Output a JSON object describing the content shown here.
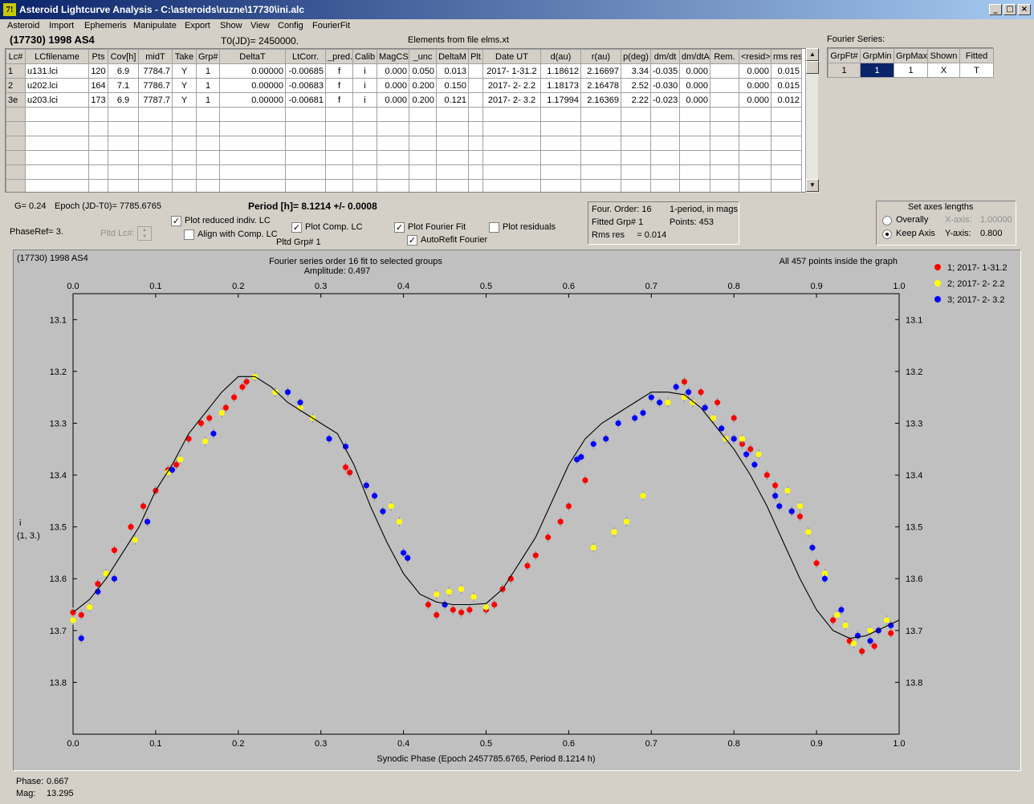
{
  "window": {
    "title": "Asteroid Lightcurve Analysis - C:\\asteroids\\ruzne\\17730\\ini.alc",
    "app_icon": "7!"
  },
  "menu": [
    "Asteroid",
    "Import",
    "Ephemeris",
    "Manipulate",
    "Export",
    "Show",
    "View",
    "Config",
    "FourierFit"
  ],
  "header": {
    "object": "(17730) 1998 AS4",
    "t0": "T0(JD)= 2450000.",
    "elements": "Elements from file elms.xt"
  },
  "lc_table": {
    "columns": [
      "Lc#",
      "LCfilename",
      "Pts",
      "Cov[h]",
      "midT",
      "Take",
      "Grp#",
      "DeltaT",
      "LtCorr.",
      "_pred.",
      "Calib",
      "MagCS",
      "_unc",
      "DeltaM",
      "Plt",
      "Date UT",
      "d(au)",
      "r(au)",
      "p(deg)",
      "dm/dt",
      "dm/dtA",
      "Rem.",
      "<resid>",
      "rms res"
    ],
    "rows": [
      [
        "1",
        "u131.lci",
        "120",
        "6.9",
        "7784.7",
        "Y",
        "1",
        "0.00000",
        "-0.00685",
        "f",
        "i",
        "0.000",
        "0.050",
        "0.013",
        "",
        "2017- 1-31.2",
        "1.18612",
        "2.16697",
        "3.34",
        "-0.035",
        "0.000",
        "",
        "0.000",
        "0.015"
      ],
      [
        "2",
        "u202.lci",
        "164",
        "7.1",
        "7786.7",
        "Y",
        "1",
        "0.00000",
        "-0.00683",
        "f",
        "i",
        "0.000",
        "0.200",
        "0.150",
        "",
        "2017- 2- 2.2",
        "1.18173",
        "2.16478",
        "2.52",
        "-0.030",
        "0.000",
        "",
        "0.000",
        "0.015"
      ],
      [
        "3e",
        "u203.lci",
        "173",
        "6.9",
        "7787.7",
        "Y",
        "1",
        "0.00000",
        "-0.00681",
        "f",
        "i",
        "0.000",
        "0.200",
        "0.121",
        "",
        "2017- 2- 3.2",
        "1.17994",
        "2.16369",
        "2.22",
        "-0.023",
        "0.000",
        "",
        "0.000",
        "0.012"
      ]
    ]
  },
  "fourier_series": {
    "label": "Fourier Series:",
    "columns": [
      "GrpFt#",
      "GrpMin",
      "GrpMax",
      "Shown",
      "Fitted"
    ],
    "row": [
      "1",
      "1",
      "1",
      "X",
      "T"
    ]
  },
  "params": {
    "g": "G= 0.24",
    "epoch": "Epoch (JD-T0)= 7785.6765",
    "period": "Period [h]= 8.1214 +/- 0.0008",
    "phaseref": "PhaseRef= 3.",
    "pltd_lc": "Pltd Lc#:",
    "pltd_grp": "Pltd Grp#  1"
  },
  "checkboxes": {
    "plot_reduced": {
      "label": "Plot reduced indiv. LC",
      "checked": true
    },
    "align_comp": {
      "label": "Align with Comp. LC",
      "checked": false
    },
    "plot_comp": {
      "label": "Plot Comp. LC",
      "checked": true
    },
    "plot_fourier": {
      "label": "Plot Fourier Fit",
      "checked": true
    },
    "plot_residuals": {
      "label": "Plot residuals",
      "checked": false
    },
    "autorefit": {
      "label": "AutoRefit Fourier",
      "checked": true
    }
  },
  "fit_info": {
    "order": "Four. Order: 16",
    "period_mode": "1-period, in mags",
    "fitted_grp": "Fitted Grp# 1",
    "points": "Points: 453",
    "rms": "Rms res     = 0.014"
  },
  "axes_box": {
    "title": "Set axes lengths",
    "overally": "Overally",
    "keep_axis": "Keep Axis",
    "x_label": "X-axis:",
    "x_value": "1.00000",
    "y_label": "Y-axis:",
    "y_value": "0.800",
    "selected": "keep_axis"
  },
  "status": {
    "phase_label": "Phase:",
    "phase_value": "0.667",
    "mag_label": "Mag:",
    "mag_value": "13.295"
  },
  "chart_data": {
    "type": "scatter",
    "title_left": "(17730) 1998 AS4",
    "title": "Fourier series order 16 fit to selected groups",
    "subtitle": "Amplitude: 0.497",
    "note_right": "All 457 points inside the graph",
    "xlabel": "Synodic Phase (Epoch 2457785.6765, Period 8.1214 h)",
    "ylabel": "i",
    "ylabel2": "(1, 3.)",
    "xlim": [
      0,
      1
    ],
    "ylim": [
      13.1,
      13.9
    ],
    "y_inverted": true,
    "xticks": [
      0,
      0.1,
      0.2,
      0.3,
      0.4,
      0.5,
      0.6,
      0.7,
      0.8,
      0.9,
      1
    ],
    "xtick_labels": [
      "0.0",
      "0.1",
      "0.2",
      "0.3",
      "0.4",
      "0.5",
      "0.6",
      "0.7",
      "0.8",
      "0.9",
      "1.0"
    ],
    "yticks": [
      13.1,
      13.2,
      13.3,
      13.4,
      13.5,
      13.6,
      13.7,
      13.8
    ],
    "ytick_labels": [
      "13.1",
      "13.2",
      "13.3",
      "13.4",
      "13.5",
      "13.6",
      "13.7",
      "13.8"
    ],
    "background": "#c0c0c0",
    "fit_curve": {
      "x": [
        0.0,
        0.02,
        0.04,
        0.06,
        0.08,
        0.1,
        0.12,
        0.14,
        0.16,
        0.18,
        0.2,
        0.22,
        0.24,
        0.26,
        0.28,
        0.3,
        0.32,
        0.34,
        0.36,
        0.38,
        0.4,
        0.42,
        0.44,
        0.46,
        0.48,
        0.5,
        0.52,
        0.54,
        0.56,
        0.58,
        0.6,
        0.62,
        0.64,
        0.66,
        0.68,
        0.7,
        0.72,
        0.74,
        0.76,
        0.78,
        0.8,
        0.82,
        0.84,
        0.86,
        0.88,
        0.9,
        0.92,
        0.94,
        0.96,
        0.98,
        1.0
      ],
      "y": [
        13.665,
        13.64,
        13.6,
        13.55,
        13.5,
        13.43,
        13.38,
        13.32,
        13.28,
        13.24,
        13.21,
        13.21,
        13.23,
        13.26,
        13.28,
        13.3,
        13.32,
        13.38,
        13.46,
        13.53,
        13.59,
        13.63,
        13.645,
        13.65,
        13.65,
        13.648,
        13.62,
        13.57,
        13.52,
        13.45,
        13.38,
        13.33,
        13.3,
        13.28,
        13.26,
        13.24,
        13.24,
        13.245,
        13.27,
        13.31,
        13.35,
        13.4,
        13.46,
        13.53,
        13.6,
        13.66,
        13.7,
        13.715,
        13.71,
        13.695,
        13.68
      ]
    },
    "series": [
      {
        "name": "1; 2017- 1-31.2",
        "color": "#ff0000",
        "x": [
          0.0,
          0.01,
          0.03,
          0.05,
          0.07,
          0.085,
          0.1,
          0.115,
          0.125,
          0.14,
          0.155,
          0.165,
          0.185,
          0.195,
          0.205,
          0.21,
          0.33,
          0.335,
          0.43,
          0.44,
          0.46,
          0.47,
          0.48,
          0.5,
          0.51,
          0.52,
          0.53,
          0.55,
          0.56,
          0.575,
          0.59,
          0.6,
          0.62,
          0.74,
          0.76,
          0.78,
          0.8,
          0.81,
          0.82,
          0.84,
          0.85,
          0.87,
          0.88,
          0.9,
          0.92,
          0.94,
          0.955,
          0.97,
          0.99
        ],
        "y": [
          13.665,
          13.67,
          13.61,
          13.545,
          13.5,
          13.46,
          13.43,
          13.39,
          13.38,
          13.33,
          13.3,
          13.29,
          13.27,
          13.25,
          13.23,
          13.22,
          13.385,
          13.395,
          13.65,
          13.67,
          13.66,
          13.665,
          13.66,
          13.66,
          13.65,
          13.62,
          13.6,
          13.575,
          13.555,
          13.52,
          13.49,
          13.46,
          13.41,
          13.22,
          13.24,
          13.26,
          13.29,
          13.34,
          13.35,
          13.4,
          13.42,
          13.47,
          13.48,
          13.57,
          13.68,
          13.72,
          13.74,
          13.73,
          13.705
        ]
      },
      {
        "name": "2; 2017- 2- 2.2",
        "color": "#ffff00",
        "x": [
          0.0,
          0.02,
          0.04,
          0.075,
          0.115,
          0.13,
          0.16,
          0.18,
          0.22,
          0.245,
          0.275,
          0.29,
          0.385,
          0.395,
          0.44,
          0.455,
          0.47,
          0.485,
          0.5,
          0.63,
          0.655,
          0.67,
          0.69,
          0.72,
          0.74,
          0.75,
          0.775,
          0.79,
          0.81,
          0.83,
          0.865,
          0.88,
          0.89,
          0.91,
          0.925,
          0.935,
          0.945,
          0.965,
          0.985
        ],
        "y": [
          13.68,
          13.655,
          13.59,
          13.525,
          13.395,
          13.37,
          13.335,
          13.28,
          13.21,
          13.24,
          13.27,
          13.29,
          13.46,
          13.49,
          13.63,
          13.625,
          13.62,
          13.635,
          13.655,
          13.54,
          13.51,
          13.49,
          13.44,
          13.26,
          13.25,
          13.26,
          13.29,
          13.33,
          13.33,
          13.36,
          13.43,
          13.46,
          13.51,
          13.59,
          13.67,
          13.69,
          13.725,
          13.7,
          13.68
        ]
      },
      {
        "name": "3; 2017- 2- 3.2",
        "color": "#0000ff",
        "x": [
          0.01,
          0.03,
          0.05,
          0.09,
          0.12,
          0.17,
          0.26,
          0.275,
          0.31,
          0.33,
          0.355,
          0.365,
          0.375,
          0.4,
          0.405,
          0.45,
          0.61,
          0.615,
          0.63,
          0.645,
          0.66,
          0.68,
          0.69,
          0.7,
          0.71,
          0.73,
          0.745,
          0.765,
          0.785,
          0.8,
          0.815,
          0.825,
          0.85,
          0.855,
          0.87,
          0.895,
          0.91,
          0.93,
          0.95,
          0.965,
          0.975,
          0.99
        ],
        "y": [
          13.715,
          13.625,
          13.6,
          13.49,
          13.39,
          13.32,
          13.24,
          13.26,
          13.33,
          13.345,
          13.42,
          13.44,
          13.47,
          13.55,
          13.56,
          13.65,
          13.37,
          13.365,
          13.34,
          13.33,
          13.3,
          13.29,
          13.28,
          13.25,
          13.26,
          13.23,
          13.24,
          13.27,
          13.31,
          13.33,
          13.36,
          13.38,
          13.44,
          13.46,
          13.47,
          13.54,
          13.6,
          13.66,
          13.71,
          13.72,
          13.7,
          13.69
        ]
      }
    ]
  }
}
